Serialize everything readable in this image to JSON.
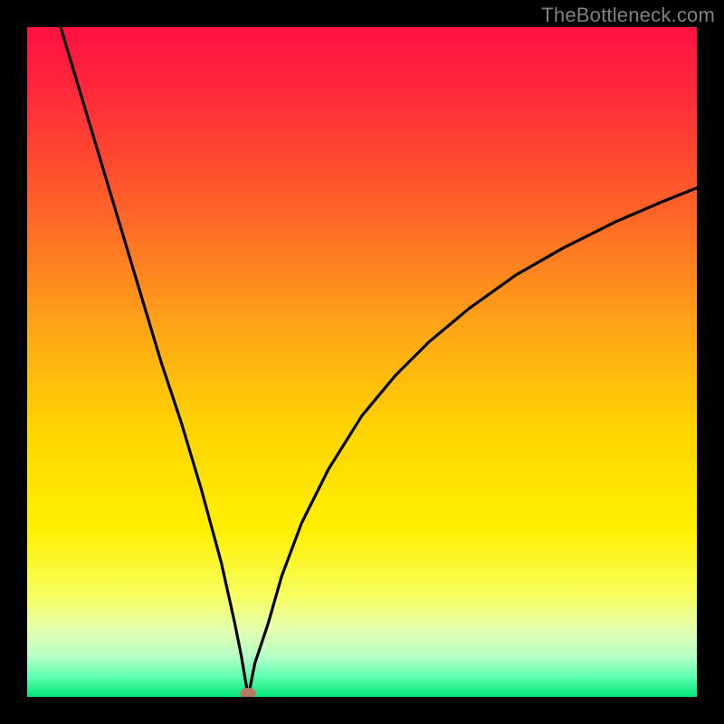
{
  "watermark": "TheBottleneck.com",
  "colors": {
    "gradient_stops": [
      {
        "offset": 0.0,
        "color": "#ff1040"
      },
      {
        "offset": 0.1,
        "color": "#ff2a3a"
      },
      {
        "offset": 0.25,
        "color": "#ff5a2a"
      },
      {
        "offset": 0.45,
        "color": "#ffa617"
      },
      {
        "offset": 0.6,
        "color": "#ffd400"
      },
      {
        "offset": 0.75,
        "color": "#fff000"
      },
      {
        "offset": 0.85,
        "color": "#f7ff60"
      },
      {
        "offset": 0.9,
        "color": "#e5ffb0"
      },
      {
        "offset": 0.94,
        "color": "#b5ffc5"
      },
      {
        "offset": 0.97,
        "color": "#60ffb0"
      },
      {
        "offset": 1.0,
        "color": "#00e878"
      }
    ],
    "curve": "#000000",
    "dot": "#bb7766",
    "frame": "#000000"
  },
  "chart_data": {
    "type": "line",
    "title": "",
    "xlabel": "",
    "ylabel": "",
    "xlim": [
      0,
      100
    ],
    "ylim": [
      0,
      100
    ],
    "minimum_point": {
      "x": 33,
      "y": 0
    },
    "series": [
      {
        "name": "bottleneck-curve",
        "x": [
          5,
          8,
          11,
          14,
          17,
          20,
          23,
          26,
          29,
          31,
          32,
          33,
          34,
          36,
          38,
          41,
          45,
          50,
          55,
          60,
          66,
          73,
          80,
          88,
          95,
          100
        ],
        "values": [
          100,
          90,
          80,
          70,
          60,
          50,
          41,
          31,
          20,
          11,
          6,
          0,
          5,
          11,
          18,
          26,
          34,
          42,
          48,
          53,
          58,
          63,
          67,
          71,
          74,
          76
        ]
      }
    ],
    "annotations": [
      {
        "type": "point",
        "name": "optimal-dot",
        "x": 33,
        "y": 0
      }
    ]
  }
}
